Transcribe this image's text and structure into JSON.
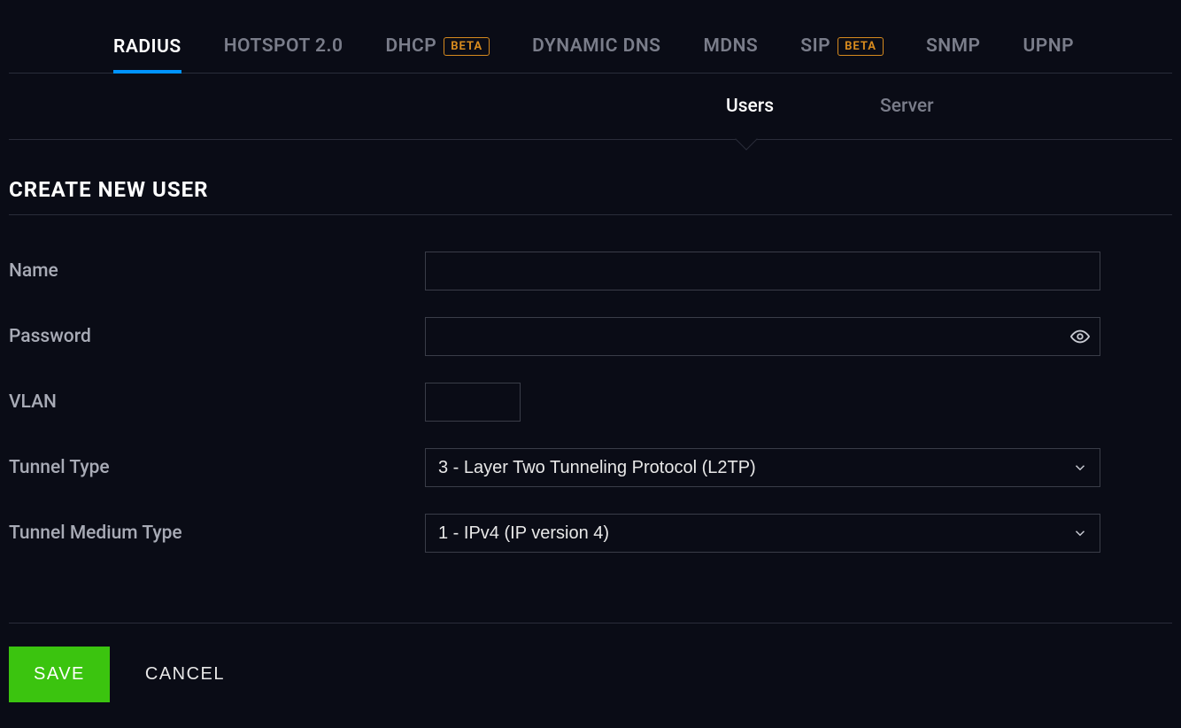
{
  "topTabs": [
    {
      "label": "RADIUS",
      "badge": null,
      "active": true
    },
    {
      "label": "HOTSPOT 2.0",
      "badge": null,
      "active": false
    },
    {
      "label": "DHCP",
      "badge": "BETA",
      "active": false
    },
    {
      "label": "DYNAMIC DNS",
      "badge": null,
      "active": false
    },
    {
      "label": "MDNS",
      "badge": null,
      "active": false
    },
    {
      "label": "SIP",
      "badge": "BETA",
      "active": false
    },
    {
      "label": "SNMP",
      "badge": null,
      "active": false
    },
    {
      "label": "UPNP",
      "badge": null,
      "active": false
    }
  ],
  "subTabs": {
    "users": "Users",
    "server": "Server",
    "active": "users"
  },
  "section": {
    "title": "CREATE NEW USER"
  },
  "form": {
    "name": {
      "label": "Name",
      "value": ""
    },
    "password": {
      "label": "Password",
      "value": ""
    },
    "vlan": {
      "label": "VLAN",
      "value": ""
    },
    "tunnelType": {
      "label": "Tunnel Type",
      "value": "3 - Layer Two Tunneling Protocol (L2TP)"
    },
    "tunnelMediumType": {
      "label": "Tunnel Medium Type",
      "value": "1 - IPv4 (IP version 4)"
    }
  },
  "actions": {
    "save": "SAVE",
    "cancel": "CANCEL"
  }
}
